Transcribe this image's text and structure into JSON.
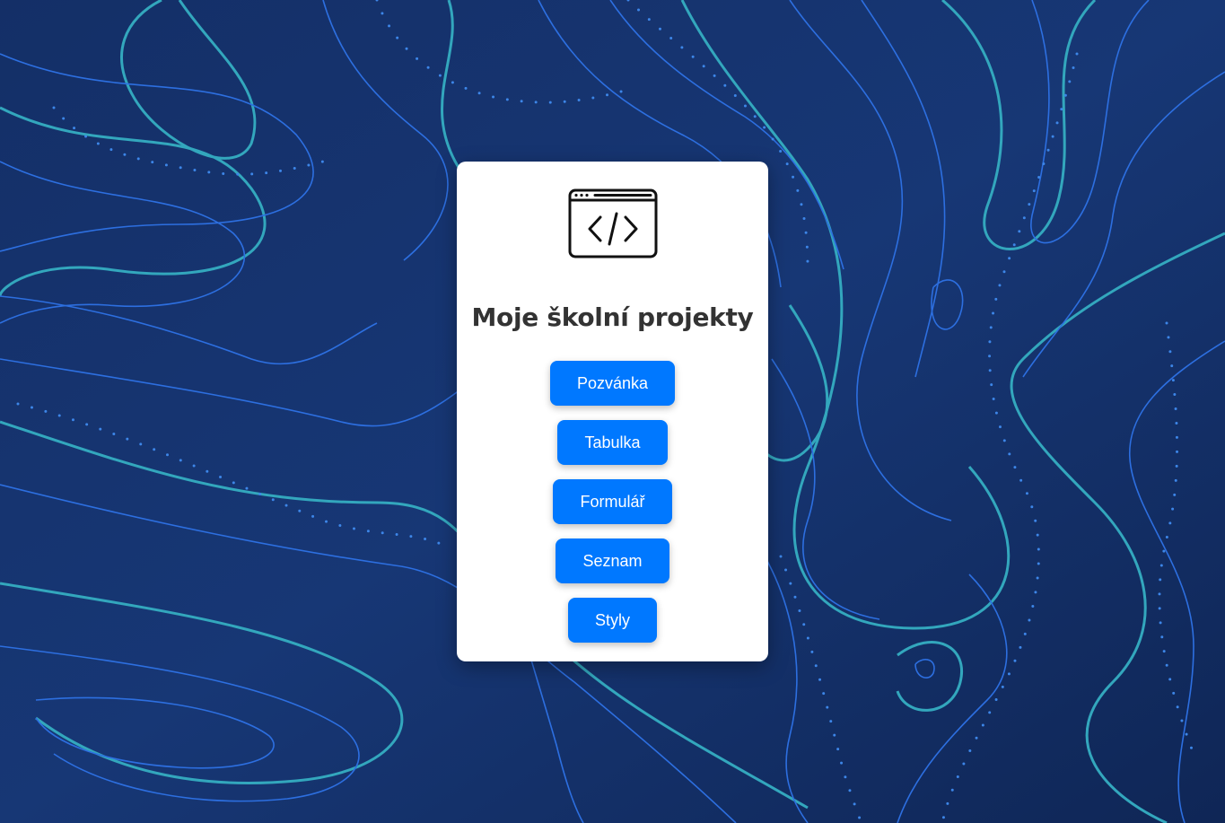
{
  "page": {
    "title": "Moje školní projekty"
  },
  "icons": {
    "logo": "browser-code-icon"
  },
  "buttons": [
    {
      "label": "Pozvánka"
    },
    {
      "label": "Tabulka"
    },
    {
      "label": "Formulář"
    },
    {
      "label": "Seznam"
    },
    {
      "label": "Styly"
    }
  ],
  "colors": {
    "background": "#13306a",
    "card": "#ffffff",
    "button": "#0078ff",
    "button_text": "#ffffff",
    "title": "#333333",
    "contour_cyan": "#33a7bd",
    "contour_blue": "#2d6fe0"
  }
}
